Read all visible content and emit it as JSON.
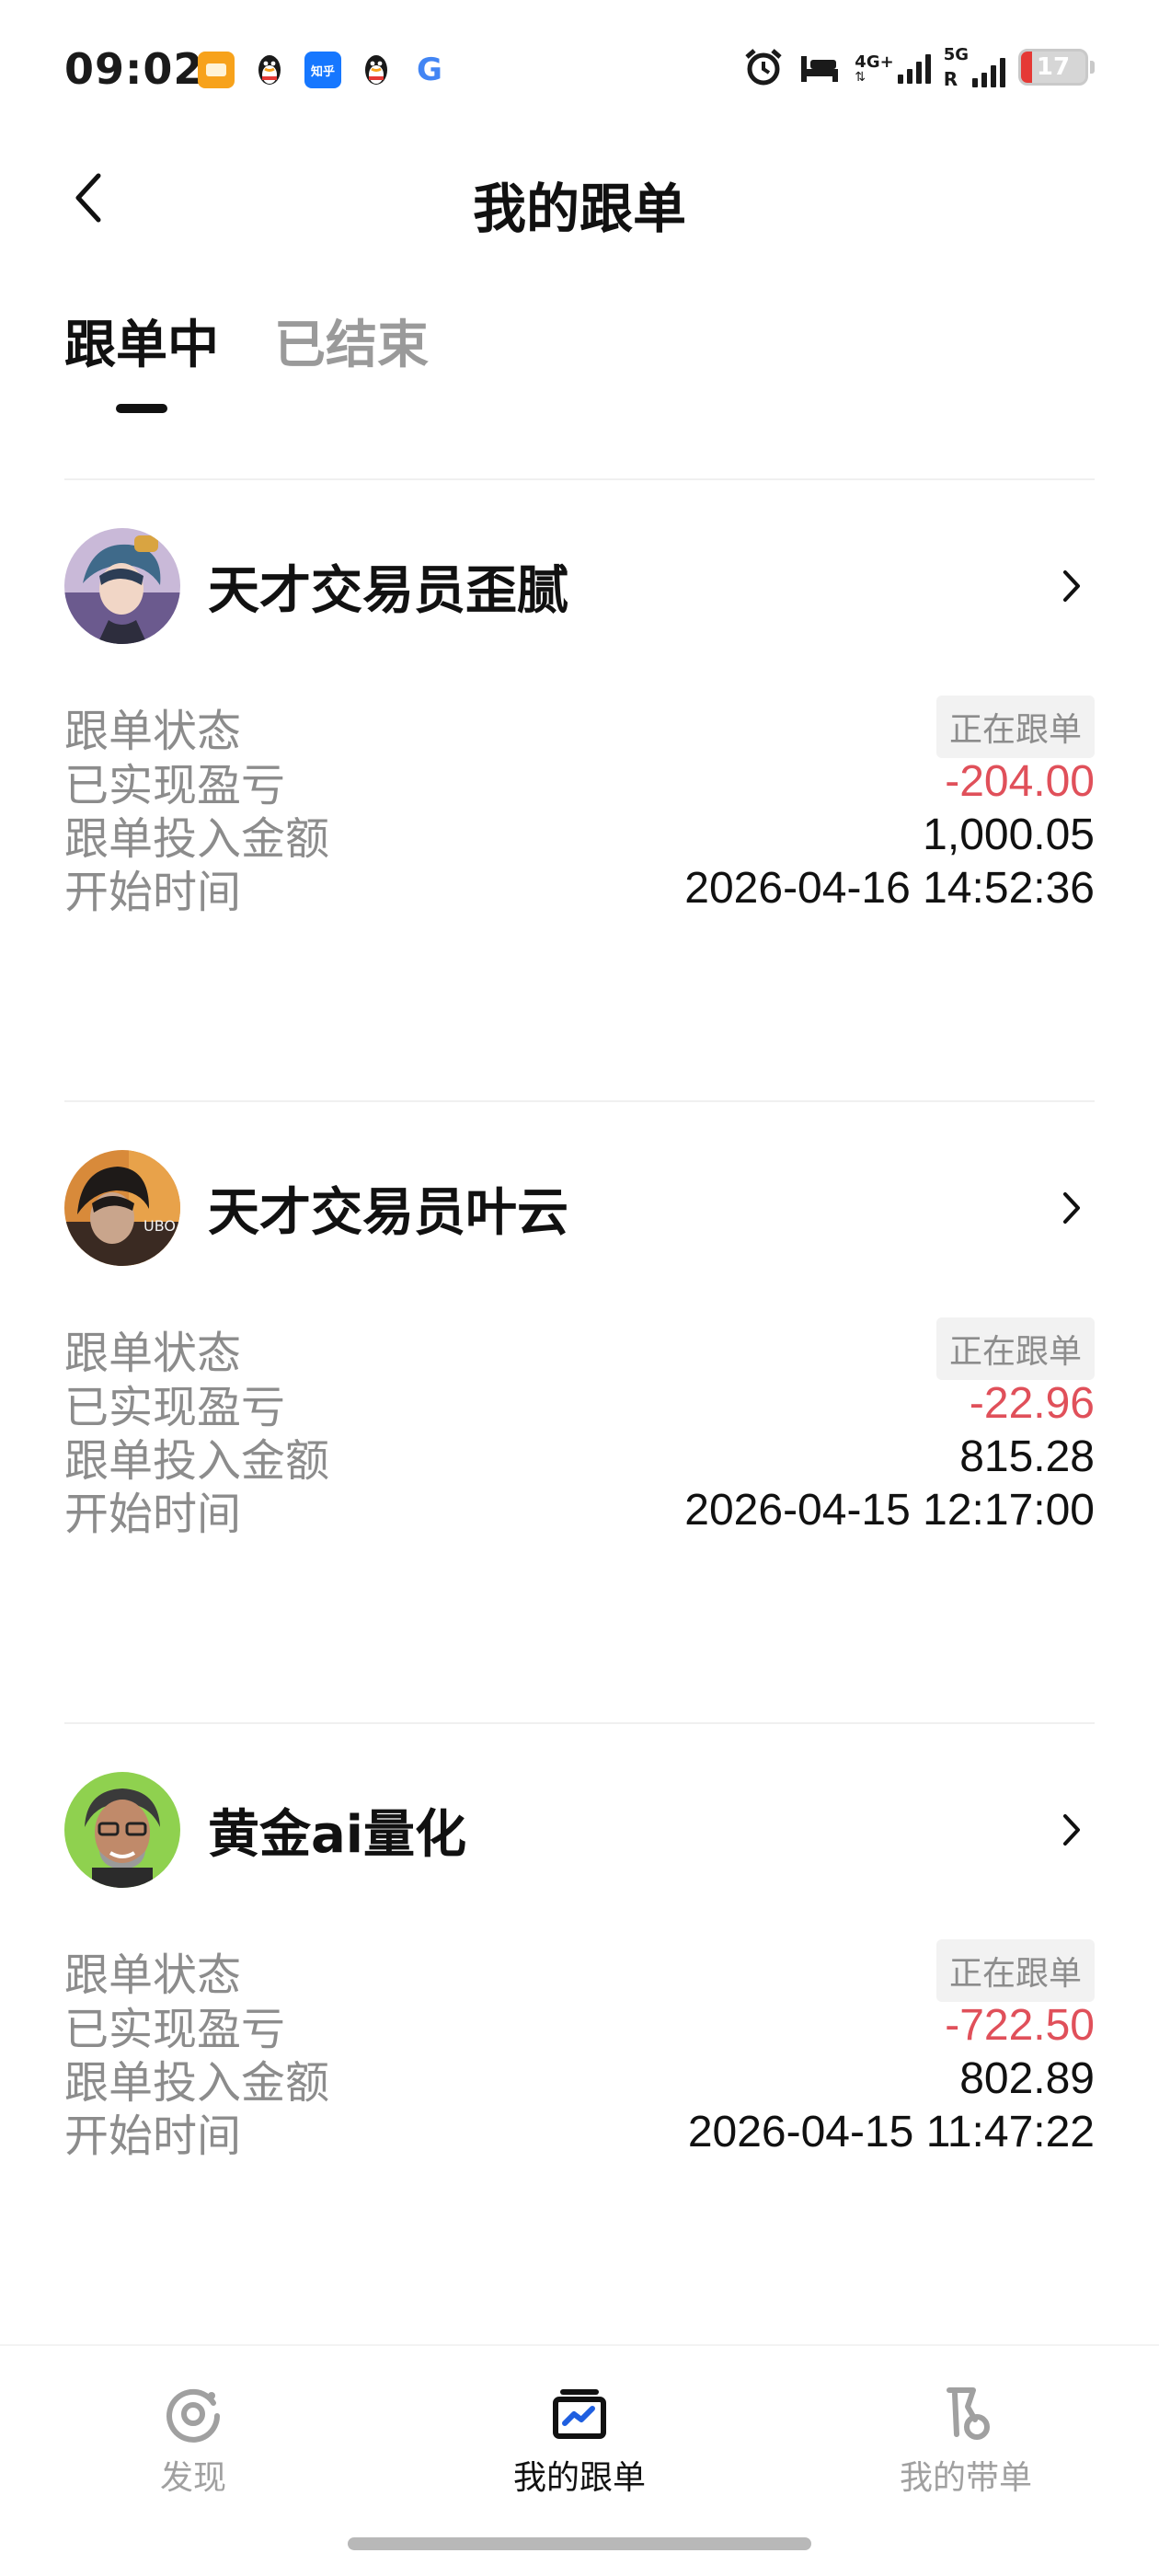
{
  "status_bar": {
    "time": "09:02",
    "notification_icons": [
      "app-orange-icon",
      "qq-icon",
      "zhihu-icon",
      "qq-icon",
      "google-icon"
    ],
    "zhihu_label": "知乎",
    "google_label": "G",
    "signal1_label": "4G+",
    "signal2_label": "5G",
    "signal2_sub": "R",
    "battery_percent": "17",
    "battery_level": 0.17
  },
  "header": {
    "title": "我的跟单",
    "back_icon": "chevron-left-icon"
  },
  "tabs": [
    {
      "label": "跟单中",
      "active": true
    },
    {
      "label": "已结束",
      "active": false
    }
  ],
  "labels": {
    "status": "跟单状态",
    "pnl": "已实现盈亏",
    "invest": "跟单投入金额",
    "start": "开始时间"
  },
  "cards": [
    {
      "name": "天才交易员歪腻",
      "status": "正在跟单",
      "pnl": "-204.00",
      "invest": "1,000.05",
      "start": "2026-04-16 14:52:36"
    },
    {
      "name": "天才交易员叶云",
      "status": "正在跟单",
      "pnl": "-22.96",
      "invest": "815.28",
      "start": "2026-04-15 12:17:00"
    },
    {
      "name": "黄金ai量化",
      "status": "正在跟单",
      "pnl": "-722.50",
      "invest": "802.89",
      "start": "2026-04-15 11:47:22"
    }
  ],
  "bottom_nav": [
    {
      "label": "发现",
      "icon": "discover-icon",
      "active": false
    },
    {
      "label": "我的跟单",
      "icon": "copy-trade-icon",
      "active": true
    },
    {
      "label": "我的带单",
      "icon": "lead-trade-icon",
      "active": false
    }
  ],
  "colors": {
    "negative": "#e0505a",
    "muted": "#8c8c8c",
    "primary_text": "#111111"
  }
}
